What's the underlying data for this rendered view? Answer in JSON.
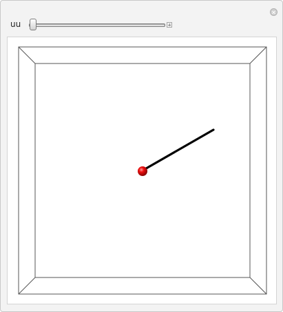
{
  "controls": {
    "slider_label": "uu",
    "slider_value": 0.0
  },
  "colors": {
    "ball": "#dd0000",
    "rod": "#000000",
    "frame": "#555555"
  },
  "icons": {
    "close": "close-circle-icon",
    "expand": "plus-icon"
  }
}
